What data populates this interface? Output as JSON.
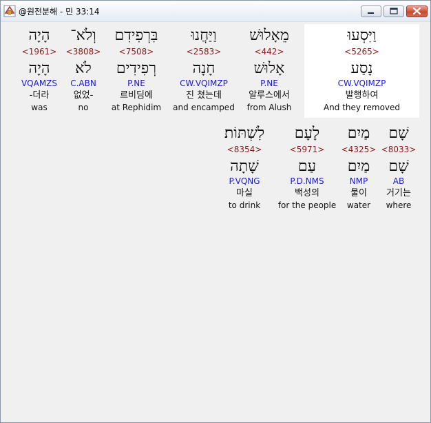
{
  "window": {
    "title": "@원전분해 - 민 33:14"
  },
  "colors": {
    "strong_number": "#8a1a1a",
    "parsing": "#1a1acc",
    "highlight": "#ffffff"
  },
  "verse_lines": [
    {
      "words": [
        {
          "hebrew": "וַיִּסְעוּ",
          "strong": "<5265>",
          "lemma": "נָסַע",
          "parsing": "CW.VQIMZP",
          "korean": "발행하여",
          "english": "And they removed"
        },
        {
          "hebrew": "מֵאָלוּשׁ",
          "strong": "<442>",
          "lemma": "אָלוּשׁ",
          "parsing": "P.NE",
          "korean": "알루스에서",
          "english": "from Alush"
        },
        {
          "hebrew": "וַיַּחֲנוּ",
          "strong": "<2583>",
          "lemma": "חָנָה",
          "parsing": "CW.VQIMZP",
          "korean": "진 쳤는데",
          "english": "and encamped"
        },
        {
          "hebrew": "בִּרְפִידִם",
          "strong": "<7508>",
          "lemma": "רְפִידִים",
          "parsing": "P.NE",
          "korean": "르비딤에",
          "english": "at Rephidim"
        },
        {
          "hebrew": "וְלֹא־",
          "strong": "<3808>",
          "lemma": "לֹא",
          "parsing": "C.ABN",
          "korean": "없었-",
          "english": "no"
        },
        {
          "hebrew": "הָיָה",
          "strong": "<1961>",
          "lemma": "הָיָה",
          "parsing": "VQAMZS",
          "korean": "-더라",
          "english": "was"
        }
      ]
    },
    {
      "words": [
        {
          "hebrew": "שָׁם",
          "strong": "<8033>",
          "lemma": "שָׁם",
          "parsing": "AB",
          "korean": "거기는",
          "english": "where"
        },
        {
          "hebrew": "מַיִם",
          "strong": "<4325>",
          "lemma": "מַיִם",
          "parsing": "NMP",
          "korean": "물이",
          "english": "water"
        },
        {
          "hebrew": "לָעָם",
          "strong": "<5971>",
          "lemma": "עַם",
          "parsing": "P.D.NMS",
          "korean": "백성의",
          "english": "for the people"
        },
        {
          "hebrew": "לִשְׁתּוֹת׃",
          "strong": "<8354>",
          "lemma": "שָׁתָה",
          "parsing": "P.VQNG",
          "korean": "마실",
          "english": "to drink"
        }
      ]
    }
  ]
}
